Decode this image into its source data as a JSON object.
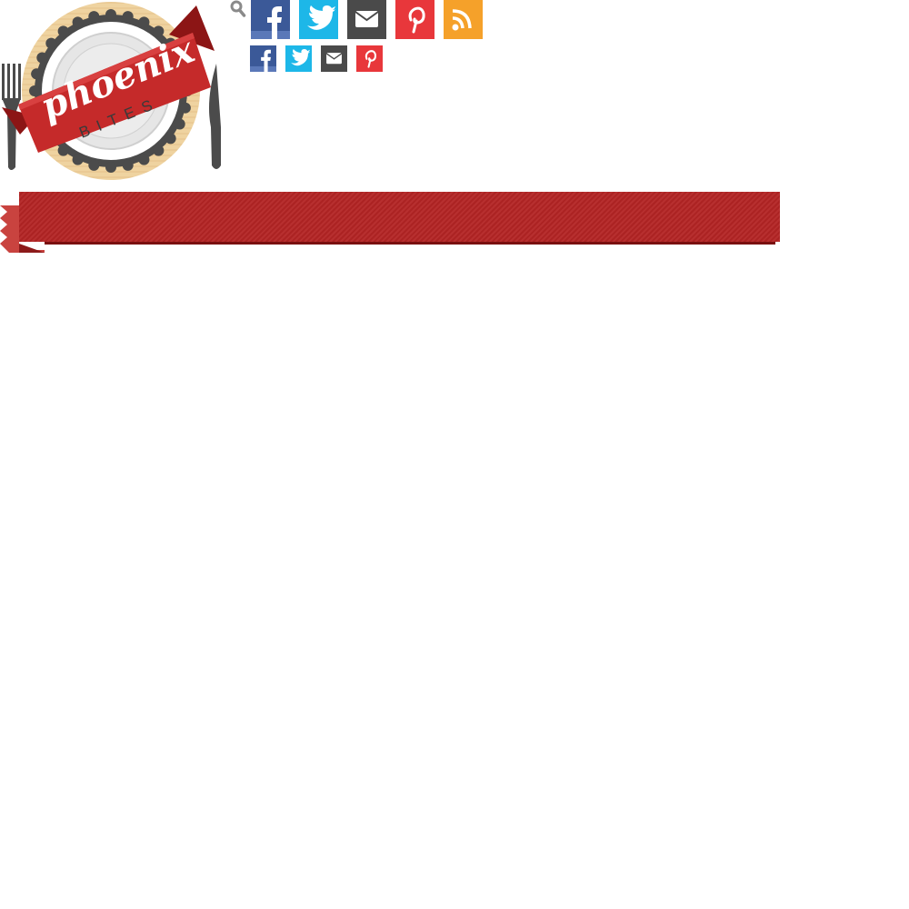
{
  "brand": {
    "logo_primary": "phoenix",
    "logo_secondary": "BITES"
  },
  "header": {
    "search_icon": "search-icon",
    "social_large": [
      {
        "name": "facebook",
        "icon": "facebook-icon",
        "color": "#3b5998"
      },
      {
        "name": "twitter",
        "icon": "twitter-icon",
        "color": "#1db7e8"
      },
      {
        "name": "email",
        "icon": "email-icon",
        "color": "#4a4a4a"
      },
      {
        "name": "pinterest",
        "icon": "pinterest-icon",
        "color": "#e8373b"
      },
      {
        "name": "rss",
        "icon": "rss-icon",
        "color": "#f5a12a"
      }
    ],
    "social_small": [
      {
        "name": "facebook",
        "icon": "facebook-icon",
        "color": "#3b5998"
      },
      {
        "name": "twitter",
        "icon": "twitter-icon",
        "color": "#1db7e8"
      },
      {
        "name": "email",
        "icon": "email-icon",
        "color": "#4a4a4a"
      },
      {
        "name": "pinterest",
        "icon": "pinterest-icon",
        "color": "#e8373b"
      }
    ]
  },
  "nav": {
    "ribbon_color": "#b32424"
  }
}
